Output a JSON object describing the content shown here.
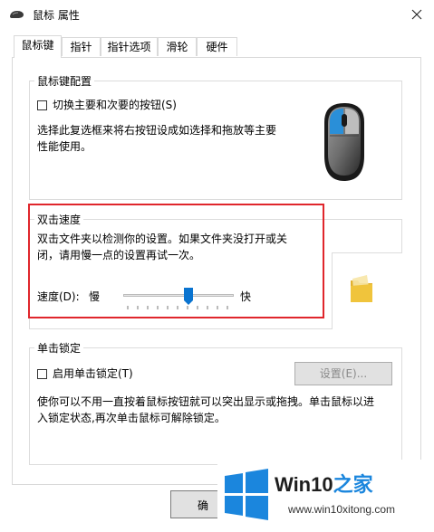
{
  "window": {
    "title": "鼠标 属性"
  },
  "tabs": [
    {
      "label": "鼠标键"
    },
    {
      "label": "指针"
    },
    {
      "label": "指针选项"
    },
    {
      "label": "滑轮"
    },
    {
      "label": "硬件"
    }
  ],
  "button_config": {
    "legend": "鼠标键配置",
    "checkbox_label": "切换主要和次要的按钮(S)",
    "checked": false,
    "description_line1": "选择此复选框来将右按钮设成如选择和拖放等主要",
    "description_line2": "性能使用。"
  },
  "double_click": {
    "legend": "双击速度",
    "description_line1": "双击文件夹以检测你的设置。如果文件夹没打开或关",
    "description_line2": "闭，请用慢一点的设置再试一次。",
    "speed_label": "速度(D):",
    "slow_label": "慢",
    "fast_label": "快",
    "slider_value_percent": 60
  },
  "click_lock": {
    "legend": "单击锁定",
    "checkbox_label": "启用单击锁定(T)",
    "checked": false,
    "settings_button": "设置(E)...",
    "description_line1": "使你可以不用一直按着鼠标按钮就可以突出显示或拖拽。单击鼠标以进",
    "description_line2": "入锁定状态,再次单击鼠标可解除锁定。"
  },
  "footer": {
    "ok_label_partial": "确"
  },
  "watermark": {
    "title_main": "Win10",
    "title_accent": "之家",
    "url": "www.win10xitong.com"
  },
  "colors": {
    "mouse_blue": "#2a8fd8",
    "highlight_red": "#e0262c",
    "win_logo_blue": "#1b86dd",
    "folder_yellow": "#f0c43c"
  }
}
